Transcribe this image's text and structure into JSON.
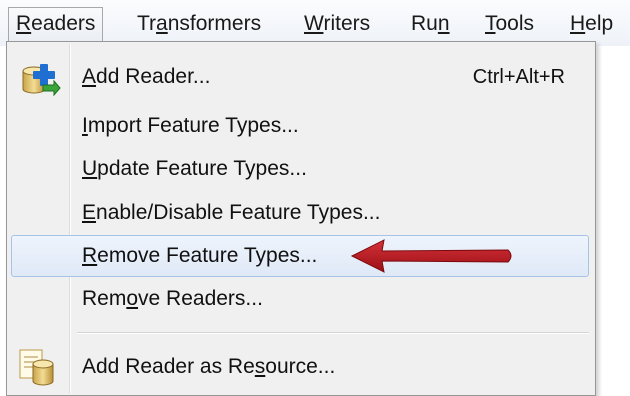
{
  "menubar": {
    "items": [
      {
        "id": "readers",
        "pre": "",
        "key": "R",
        "post": "eaders"
      },
      {
        "id": "transformers",
        "pre": "Tr",
        "key": "a",
        "post": "nsformers"
      },
      {
        "id": "writers",
        "pre": "",
        "key": "W",
        "post": "riters"
      },
      {
        "id": "run",
        "pre": "Ru",
        "key": "n",
        "post": ""
      },
      {
        "id": "tools",
        "pre": "",
        "key": "T",
        "post": "ools"
      },
      {
        "id": "help",
        "pre": "",
        "key": "H",
        "post": "elp"
      }
    ]
  },
  "menu": {
    "items": [
      {
        "pre": "",
        "key": "A",
        "post": "dd Reader...",
        "shortcut": "Ctrl+Alt+R",
        "icon": "add-reader-icon"
      },
      {
        "pre": "",
        "key": "I",
        "post": "mport Feature Types...",
        "shortcut": ""
      },
      {
        "pre": "",
        "key": "U",
        "post": "pdate Feature Types...",
        "shortcut": ""
      },
      {
        "pre": "",
        "key": "E",
        "post": "nable/Disable Feature Types...",
        "shortcut": ""
      },
      {
        "pre": "",
        "key": "R",
        "post": "emove Feature Types...",
        "shortcut": "",
        "highlighted": true
      },
      {
        "pre": "Rem",
        "key": "o",
        "post": "ve Readers...",
        "shortcut": ""
      },
      {
        "pre": "Add Reader as Re",
        "key": "s",
        "post": "ource...",
        "shortcut": "",
        "icon": "reader-resource-icon"
      }
    ]
  },
  "colors": {
    "highlight_border": "#a7c3e8",
    "arrow": "#b3151b",
    "menu_background": "#f0f0f0"
  }
}
